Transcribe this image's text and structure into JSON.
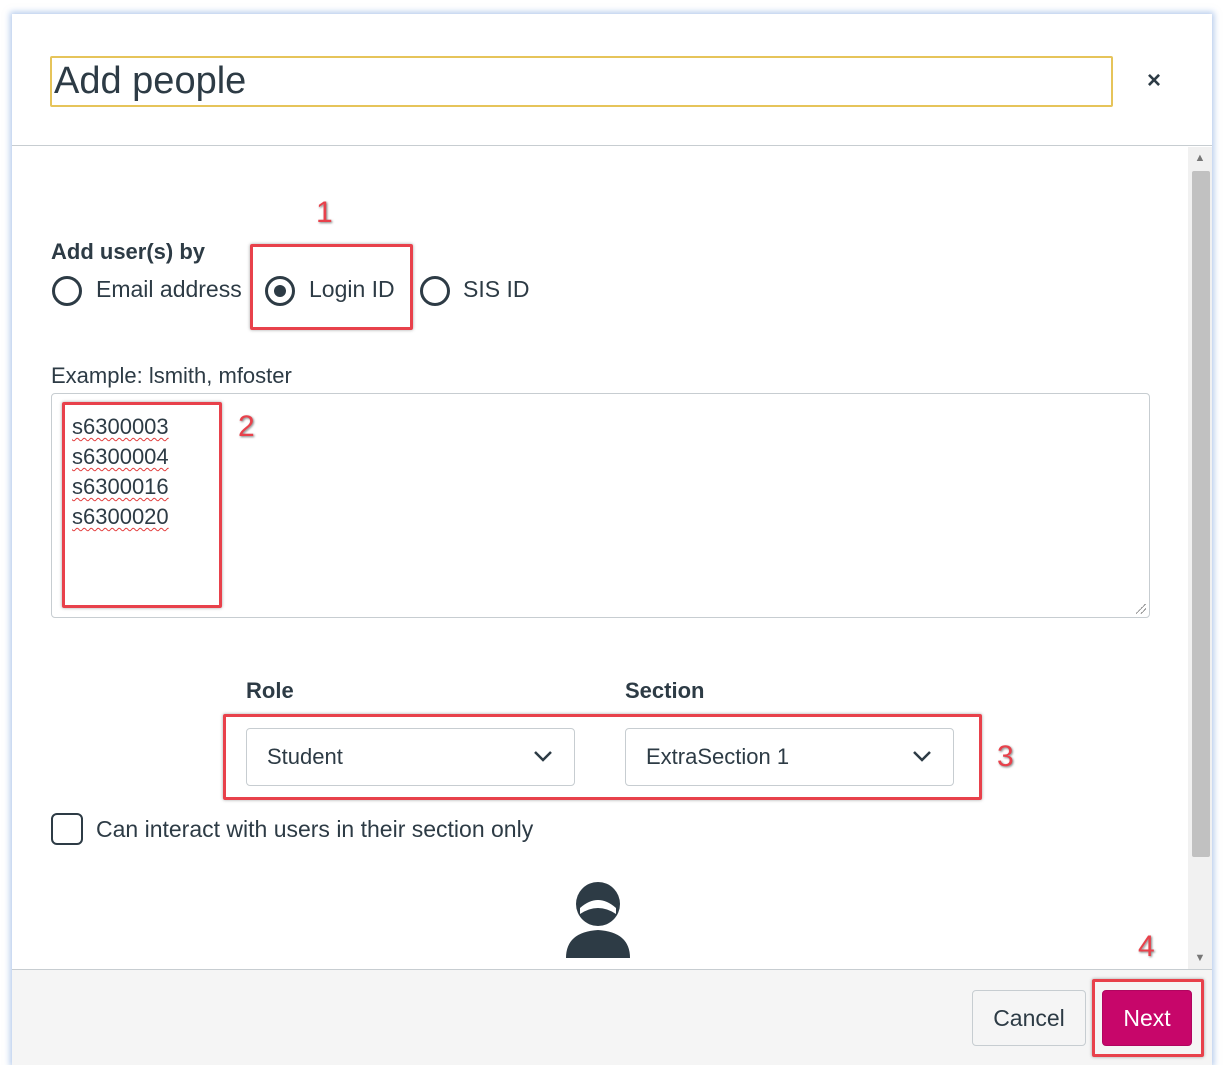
{
  "dialog": {
    "title": "Add people",
    "close_symbol": "×"
  },
  "add_by": {
    "label": "Add user(s) by",
    "options": [
      {
        "label": "Email address",
        "checked": false
      },
      {
        "label": "Login ID",
        "checked": true
      },
      {
        "label": "SIS ID",
        "checked": false
      }
    ]
  },
  "example": "Example: lsmith, mfoster",
  "user_list": [
    "s6300003",
    "s6300004",
    "s6300016",
    "s6300020"
  ],
  "role": {
    "label": "Role",
    "value": "Student"
  },
  "section": {
    "label": "Section",
    "value": "ExtraSection 1"
  },
  "limit_section": {
    "label": "Can interact with users in their section only",
    "checked": false
  },
  "footer": {
    "cancel_label": "Cancel",
    "next_label": "Next"
  },
  "annotations": [
    "1",
    "2",
    "3",
    "4"
  ],
  "colors": {
    "accent": "#c7066a",
    "annotation": "#e8414b",
    "text": "#2d3b45",
    "focus": "#e6c45a"
  }
}
